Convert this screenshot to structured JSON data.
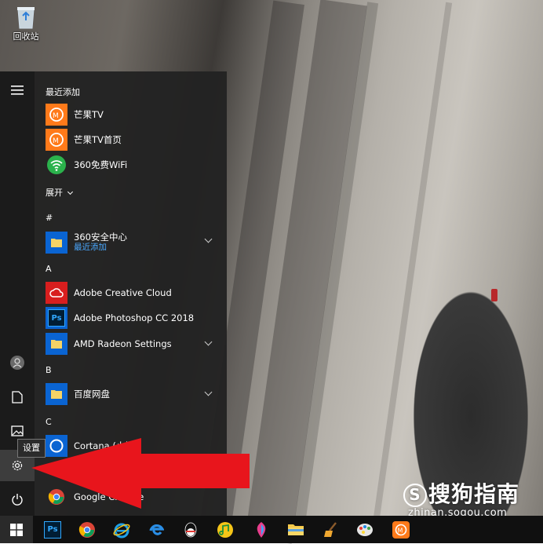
{
  "desktop": {
    "recycle_bin_label": "回收站"
  },
  "start_menu": {
    "recent_header": "最近添加",
    "recent_apps": [
      {
        "label": "芒果TV",
        "icon": "mango-tv-icon"
      },
      {
        "label": "芒果TV首页",
        "icon": "mango-tv-icon"
      },
      {
        "label": "360免费WiFi",
        "icon": "wifi-icon"
      }
    ],
    "expand_label": "展开",
    "groups": [
      {
        "letter": "#",
        "apps": [
          {
            "label": "360安全中心",
            "sublabel": "最近添加",
            "icon": "folder-icon",
            "expandable": true
          }
        ]
      },
      {
        "letter": "A",
        "apps": [
          {
            "label": "Adobe Creative Cloud",
            "icon": "creative-cloud-icon"
          },
          {
            "label": "Adobe Photoshop CC 2018",
            "icon": "photoshop-icon"
          },
          {
            "label": "AMD Radeon Settings",
            "icon": "folder-icon",
            "expandable": true
          }
        ]
      },
      {
        "letter": "B",
        "apps": [
          {
            "label": "百度网盘",
            "icon": "folder-icon",
            "expandable": true
          }
        ]
      },
      {
        "letter": "C",
        "apps": [
          {
            "label": "Cortana (小娜)",
            "icon": "cortana-icon"
          },
          {
            "label": "Google Chrome",
            "icon": "chrome-icon"
          }
        ]
      }
    ],
    "rail": {
      "menu": "hamburger-icon",
      "user": "user-icon",
      "documents": "document-icon",
      "pictures": "pictures-icon",
      "settings": "gear-icon",
      "power": "power-icon"
    },
    "tooltip": "设置"
  },
  "watermark": {
    "brand": "搜狗指南",
    "url": "zhinan.sogou.com"
  },
  "taskbar": {
    "apps": [
      "windows-start-icon",
      "photoshop-icon",
      "chrome-icon",
      "ie-icon",
      "edge-icon",
      "qq-icon",
      "music-icon",
      "paint-icon",
      "folder-icon",
      "broom-icon",
      "paint-palette-icon",
      "mango-tv-icon"
    ]
  },
  "colors": {
    "accent": "#0a64d2",
    "arrow": "#e8151c",
    "link": "#4aa8ff"
  }
}
